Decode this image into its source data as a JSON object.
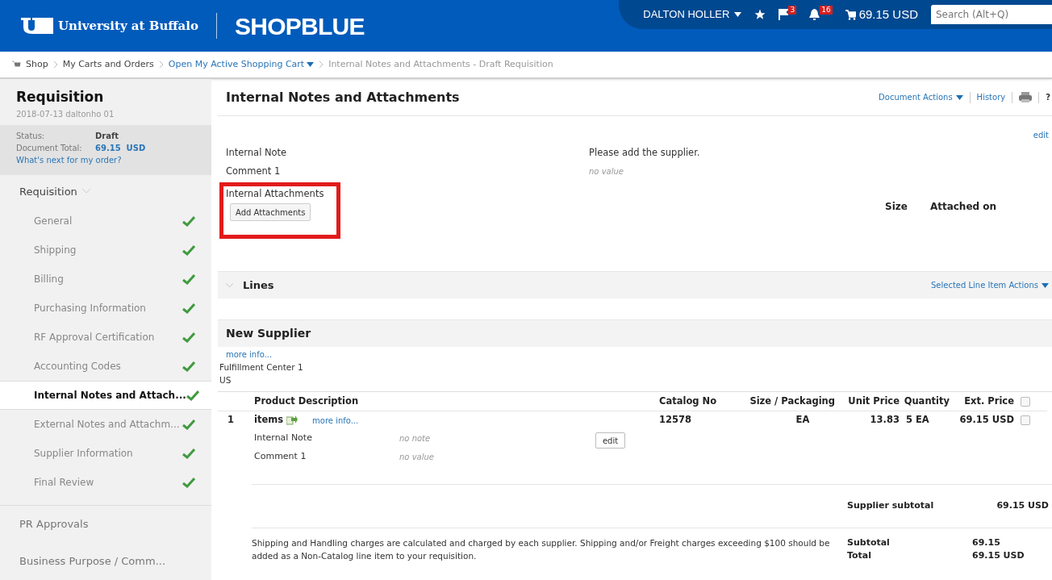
{
  "header": {
    "university": "University at Buffalo",
    "app": "SHOPBLUE",
    "user": "DALTON HOLLER",
    "flag_count": "3",
    "bell_count": "16",
    "cart_total": "69.15 USD",
    "search": {
      "placeholder": "Search (Alt+Q)"
    }
  },
  "breadcrumb": [
    {
      "label": "Shop",
      "kind": "link"
    },
    {
      "label": "My Carts and Orders",
      "kind": "link"
    },
    {
      "label": "Open My Active Shopping Cart",
      "kind": "dropdown"
    },
    {
      "label": "Internal Notes and Attachments - Draft Requisition",
      "kind": "current"
    }
  ],
  "sidebar": {
    "title": "Requisition",
    "subtitle": "2018-07-13 daltonho 01",
    "status_label": "Status:",
    "status": "Draft",
    "total_label": "Document Total:",
    "total": "69.15  USD",
    "next_link": "What's next for my order?",
    "section": "Requisition",
    "items": [
      {
        "label": "General",
        "selected": false,
        "complete": true
      },
      {
        "label": "Shipping",
        "selected": false,
        "complete": true
      },
      {
        "label": "Billing",
        "selected": false,
        "complete": true
      },
      {
        "label": "Purchasing Information",
        "selected": false,
        "complete": true
      },
      {
        "label": "RF Approval Certification",
        "selected": false,
        "complete": true
      },
      {
        "label": "Accounting Codes",
        "selected": false,
        "complete": true
      },
      {
        "label": "Internal Notes and Attach...",
        "selected": true,
        "complete": true
      },
      {
        "label": "External Notes and Attachm...",
        "selected": false,
        "complete": true
      },
      {
        "label": "Supplier Information",
        "selected": false,
        "complete": true
      },
      {
        "label": "Final Review",
        "selected": false,
        "complete": true
      }
    ],
    "other_sections": [
      "PR Approvals",
      "Business Purpose / Comm..."
    ]
  },
  "main": {
    "title": "Internal Notes and Attachments",
    "actions": [
      "Document Actions",
      "History"
    ],
    "help": "?",
    "edit": "edit",
    "fields": [
      {
        "label": "Internal Note",
        "value": "Please add the supplier.",
        "empty": false
      },
      {
        "label": "Comment 1",
        "value": "no value",
        "empty": true
      }
    ],
    "attachments_label": "Internal Attachments",
    "add_button": "Add Attachments",
    "attach_columns": [
      "Size",
      "Attached on"
    ],
    "lines_title": "Lines",
    "lines_action": "Selected Line Item Actions",
    "supplier": {
      "name": "New Supplier",
      "more_info": "more info...",
      "address": [
        "Fulfillment Center 1",
        "US"
      ]
    },
    "table": {
      "select_all_checked": false,
      "columns": [
        "Product Description",
        "Catalog No",
        "Size / Packaging",
        "Unit Price",
        "Quantity",
        "Ext. Price"
      ],
      "rows": [
        {
          "number": "1",
          "name": "items",
          "more_info": "more info...",
          "catalog": "12578",
          "packaging": "EA",
          "unit_price": "13.83",
          "quantity": "5 EA",
          "ext_price": "69.15 USD",
          "checked": false,
          "notes": [
            {
              "label": "Internal Note",
              "value": "no note"
            },
            {
              "label": "Comment 1",
              "value": "no value"
            }
          ],
          "edit": "edit"
        }
      ]
    },
    "supplier_subtotal_label": "Supplier subtotal",
    "supplier_subtotal": "69.15 USD",
    "shipping_note": "Shipping and Handling charges are calculated and charged by each supplier. Shipping and/or Freight charges exceeding $100 should be added as a Non-Catalog line item to your requisition.",
    "totals": [
      {
        "label": "Subtotal",
        "value": "69.15"
      },
      {
        "label": "Total",
        "value": "69.15 USD"
      }
    ]
  }
}
